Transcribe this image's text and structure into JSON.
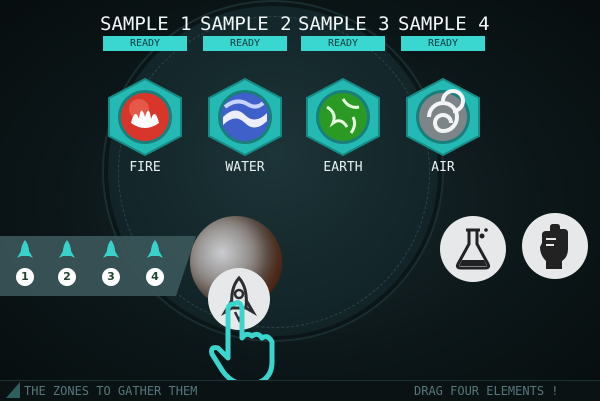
{
  "samples": [
    {
      "title": "SAMPLE 1",
      "status": "READY"
    },
    {
      "title": "SAMPLE 2",
      "status": "READY"
    },
    {
      "title": "SAMPLE 3",
      "status": "READY"
    },
    {
      "title": "SAMPLE 4",
      "status": "READY"
    }
  ],
  "elements": [
    {
      "label": "FIRE",
      "icon": "fire-icon",
      "color": "#e83a2a"
    },
    {
      "label": "WATER",
      "icon": "water-icon",
      "color": "#4a6fd6"
    },
    {
      "label": "EARTH",
      "icon": "earth-icon",
      "color": "#2fa62a"
    },
    {
      "label": "AIR",
      "icon": "air-icon",
      "color": "#8a8f92"
    }
  ],
  "rocket_slots": [
    {
      "number": "1",
      "icon": "rocket-icon"
    },
    {
      "number": "2",
      "icon": "rocket-icon"
    },
    {
      "number": "3",
      "icon": "rocket-icon"
    },
    {
      "number": "4",
      "icon": "rocket-icon"
    }
  ],
  "action_buttons": [
    {
      "icon": "flask-icon"
    },
    {
      "icon": "fist-icon"
    }
  ],
  "bottom_bar": {
    "left_text": "THE ZONES TO GATHER THEM",
    "right_text": "DRAG FOUR ELEMENTS !"
  },
  "colors": {
    "accent": "#39d7cf",
    "background": "#0c1719",
    "button": "#e6e8ea"
  }
}
